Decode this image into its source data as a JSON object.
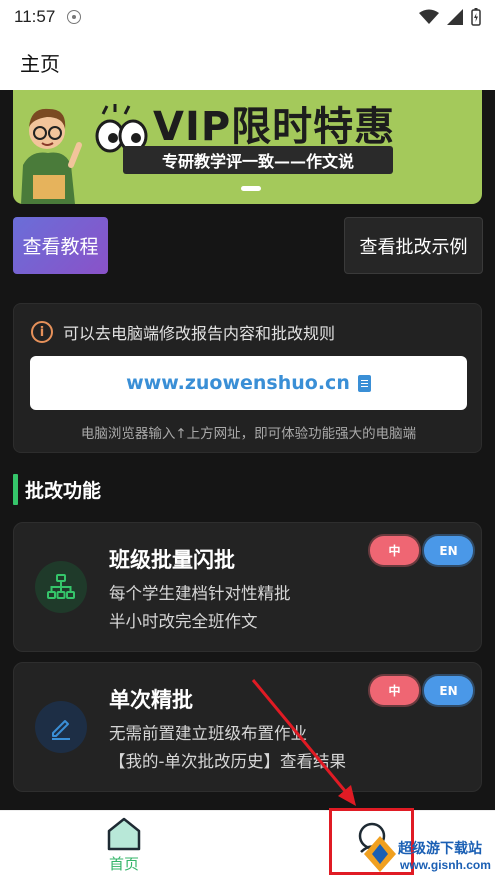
{
  "status_bar": {
    "time": "11:57"
  },
  "header": {
    "title": "主页"
  },
  "banner": {
    "title": "VIP限时特惠",
    "slogan": "专研教学评一致——作文说"
  },
  "buttons": {
    "tutorial": "查看教程",
    "example": "查看批改示例"
  },
  "info_card": {
    "notice": "可以去电脑端修改报告内容和批改规则",
    "url": "www.zuowenshuo.cn",
    "hint": "电脑浏览器输入↑上方网址，即可体验功能强大的电脑端"
  },
  "section": {
    "title": "批改功能"
  },
  "features": [
    {
      "title": "班级批量闪批",
      "line1": "每个学生建档针对性精批",
      "line2": "半小时改完全班作文",
      "badge_zh": "中",
      "badge_en": "EN",
      "icon": "org-chart-icon",
      "accent": "#35c56a"
    },
    {
      "title": "单次精批",
      "line1": "无需前置建立班级布置作业",
      "line2": "【我的-单次批改历史】查看结果",
      "badge_zh": "中",
      "badge_en": "EN",
      "icon": "pencil-icon",
      "accent": "#3a8fd6"
    }
  ],
  "bottom_nav": {
    "home_label": "首页"
  },
  "watermark": {
    "text": "超级游下载站",
    "url": "www.gisnh.com"
  },
  "colors": {
    "accent_green": "#35c56a",
    "banner_green": "#a4c95b",
    "dark_bg": "#151515",
    "annotation_red": "#e01b24"
  }
}
